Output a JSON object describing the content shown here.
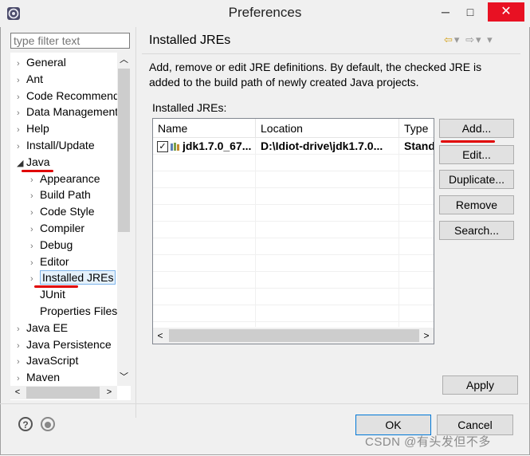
{
  "window": {
    "title": "Preferences",
    "controls": {
      "minimize": "─",
      "maximize": "□",
      "close": "✕"
    }
  },
  "filter": {
    "placeholder": "type filter text",
    "value": ""
  },
  "tree": {
    "items": [
      {
        "label": "General",
        "level": 0,
        "expander": "›"
      },
      {
        "label": "Ant",
        "level": 0,
        "expander": "›"
      },
      {
        "label": "Code Recommenders",
        "level": 0,
        "expander": "›"
      },
      {
        "label": "Data Management",
        "level": 0,
        "expander": "›"
      },
      {
        "label": "Help",
        "level": 0,
        "expander": "›"
      },
      {
        "label": "Install/Update",
        "level": 0,
        "expander": "›"
      },
      {
        "label": "Java",
        "level": 0,
        "expander": "◢",
        "expanded": true
      },
      {
        "label": "Appearance",
        "level": 1,
        "expander": "›"
      },
      {
        "label": "Build Path",
        "level": 1,
        "expander": "›"
      },
      {
        "label": "Code Style",
        "level": 1,
        "expander": "›"
      },
      {
        "label": "Compiler",
        "level": 1,
        "expander": "›"
      },
      {
        "label": "Debug",
        "level": 1,
        "expander": "›"
      },
      {
        "label": "Editor",
        "level": 1,
        "expander": "›"
      },
      {
        "label": "Installed JREs",
        "level": 1,
        "expander": "›",
        "selected": true
      },
      {
        "label": "JUnit",
        "level": 1,
        "expander": ""
      },
      {
        "label": "Properties Files Editor",
        "level": 1,
        "expander": ""
      },
      {
        "label": "Java EE",
        "level": 0,
        "expander": "›"
      },
      {
        "label": "Java Persistence",
        "level": 0,
        "expander": "›"
      },
      {
        "label": "JavaScript",
        "level": 0,
        "expander": "›"
      },
      {
        "label": "Maven",
        "level": 0,
        "expander": "›"
      }
    ],
    "scroll": {
      "up": "︿",
      "down": "﹀",
      "left": "<",
      "right": ">"
    }
  },
  "page": {
    "title": "Installed JREs",
    "nav": {
      "back": "⇦",
      "back_menu": "▾",
      "forward": "⇨",
      "forward_menu": "▾",
      "menu": "▾"
    },
    "description": "Add, remove or edit JRE definitions. By default, the checked JRE is added to the build path of newly created Java projects.",
    "list_label": "Installed JREs:"
  },
  "table": {
    "columns": [
      "Name",
      "Location",
      "Type"
    ],
    "rows": [
      {
        "checked": true,
        "check_glyph": "✓",
        "name": "jdk1.7.0_67...",
        "location": "D:\\Idiot-drive\\jdk1.7.0...",
        "type": "Standard VM"
      }
    ],
    "scroll": {
      "left": "<",
      "right": ">"
    }
  },
  "buttons": {
    "add": "Add...",
    "edit": "Edit...",
    "duplicate": "Duplicate...",
    "remove": "Remove",
    "search": "Search...",
    "apply": "Apply",
    "ok": "OK",
    "cancel": "Cancel"
  },
  "footer": {
    "help": "?",
    "watermark": "CSDN @有头发但不多"
  },
  "colors": {
    "annotation_red": "#e00000",
    "selection_border": "#7eb4ea",
    "default_button_border": "#0078d7",
    "close_button": "#e81123"
  }
}
